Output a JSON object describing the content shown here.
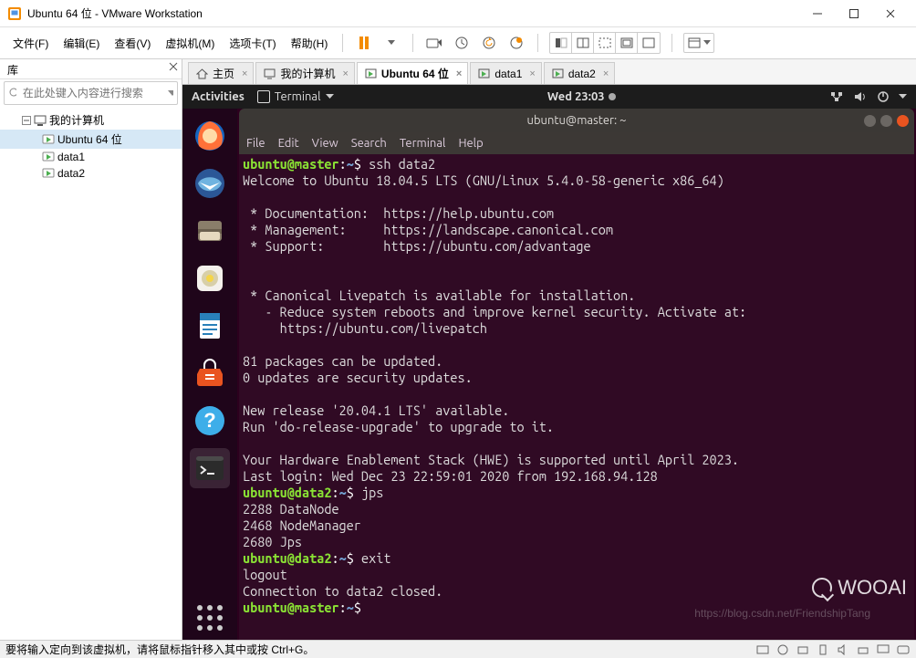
{
  "window": {
    "title": "Ubuntu 64 位 - VMware Workstation"
  },
  "menubar": {
    "items": [
      "文件(F)",
      "编辑(E)",
      "查看(V)",
      "虚拟机(M)",
      "选项卡(T)",
      "帮助(H)"
    ]
  },
  "sidebar": {
    "title": "库",
    "search_placeholder": "在此处键入内容进行搜索",
    "root": "我的计算机",
    "items": [
      {
        "label": "Ubuntu 64 位",
        "selected": true
      },
      {
        "label": "data1",
        "selected": false
      },
      {
        "label": "data2",
        "selected": false
      }
    ]
  },
  "tabs": {
    "items": [
      {
        "label": "主页",
        "icon": "home",
        "active": false
      },
      {
        "label": "我的计算机",
        "icon": "pc",
        "active": false
      },
      {
        "label": "Ubuntu 64 位",
        "icon": "vm",
        "active": true
      },
      {
        "label": "data1",
        "icon": "vm",
        "active": false
      },
      {
        "label": "data2",
        "icon": "vm",
        "active": false
      }
    ]
  },
  "ubuntu_topbar": {
    "activities": "Activities",
    "app": "Terminal",
    "clock": "Wed 23:03"
  },
  "terminal": {
    "title": "ubuntu@master: ~",
    "menus": [
      "File",
      "Edit",
      "View",
      "Search",
      "Terminal",
      "Help"
    ],
    "prompts": {
      "master": {
        "user": "ubuntu",
        "host": "master",
        "path": "~"
      },
      "data2": {
        "user": "ubuntu",
        "host": "data2",
        "path": "~"
      }
    },
    "cmd1": " ssh data2",
    "welcome": "Welcome to Ubuntu 18.04.5 LTS (GNU/Linux 5.4.0-58-generic x86_64)",
    "links": [
      " * Documentation:  https://help.ubuntu.com",
      " * Management:     https://landscape.canonical.com",
      " * Support:        https://ubuntu.com/advantage"
    ],
    "livepatch": [
      " * Canonical Livepatch is available for installation.",
      "   - Reduce system reboots and improve kernel security. Activate at:",
      "     https://ubuntu.com/livepatch"
    ],
    "updates1": "81 packages can be updated.",
    "updates2": "0 updates are security updates.",
    "release1": "New release '20.04.1 LTS' available.",
    "release2": "Run 'do-release-upgrade' to upgrade to it.",
    "hwe": "Your Hardware Enablement Stack (HWE) is supported until April 2023.",
    "lastlogin": "Last login: Wed Dec 23 22:59:01 2020 from 192.168.94.128",
    "cmd2": " jps",
    "jps": [
      "2288 DataNode",
      "2468 NodeManager",
      "2680 Jps"
    ],
    "cmd3": " exit",
    "logout": "logout",
    "closed": "Connection to data2 closed."
  },
  "statusbar": {
    "hint": "要将输入定向到该虚拟机，请将鼠标指针移入其中或按 Ctrl+G。"
  },
  "watermark": {
    "text": "WOOAI",
    "url": "https://blog.csdn.net/FriendshipTang"
  },
  "colors": {
    "term_bg": "#300a24",
    "prompt_green": "#8ae234",
    "prompt_blue": "#729fcf",
    "close_red": "#e95420"
  }
}
